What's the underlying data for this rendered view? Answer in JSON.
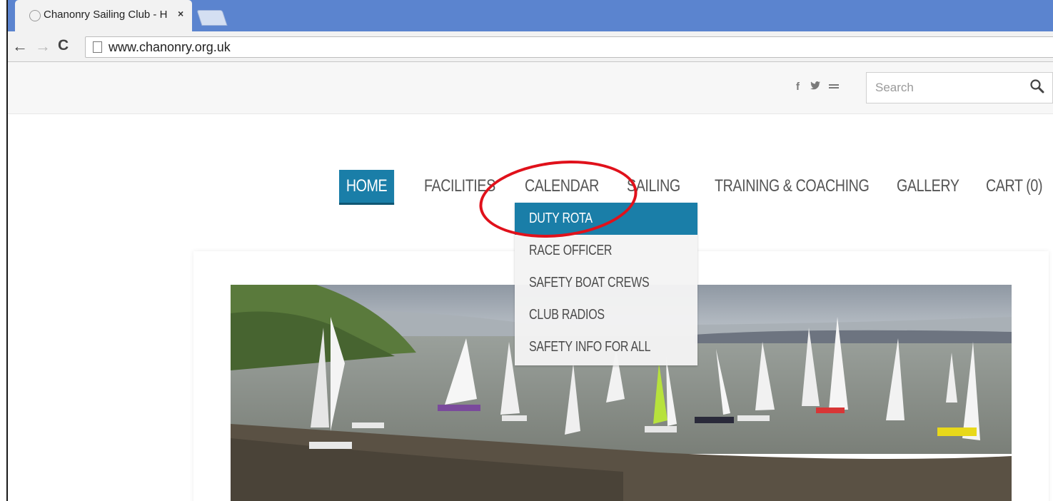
{
  "browser": {
    "tab_title": "Chanonry Sailing Club - H",
    "tab_close": "×",
    "url": "www.chanonry.org.uk",
    "back_glyph": "←",
    "forward_glyph": "→",
    "reload_glyph": "C"
  },
  "header": {
    "social": {
      "facebook": "f",
      "twitter": "𝕪",
      "email": "✉"
    },
    "search": {
      "placeholder": "Search",
      "icon": "search-icon"
    }
  },
  "nav": {
    "items": [
      {
        "label": "HOME",
        "active": true
      },
      {
        "label": "FACILITIES"
      },
      {
        "label": "CALENDAR"
      },
      {
        "label": "SAILING"
      },
      {
        "label": "TRAINING & COACHING"
      },
      {
        "label": "GALLERY"
      },
      {
        "label": "CART (0)"
      }
    ],
    "dropdown": [
      {
        "label": "DUTY ROTA",
        "active": true
      },
      {
        "label": "RACE OFFICER"
      },
      {
        "label": "SAFETY BOAT CREWS"
      },
      {
        "label": "CLUB RADIOS"
      },
      {
        "label": "SAFETY INFO FOR ALL"
      }
    ]
  },
  "colors": {
    "accent": "#1a7ea8",
    "tabstrip": "#5b84cf",
    "annotation": "#e0111b"
  }
}
